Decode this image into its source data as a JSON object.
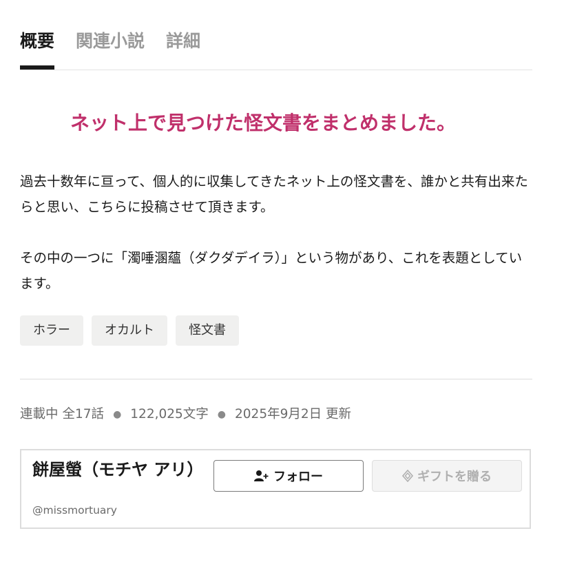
{
  "tabs": [
    {
      "label": "概要",
      "active": true
    },
    {
      "label": "関連小説",
      "active": false
    },
    {
      "label": "詳細",
      "active": false
    }
  ],
  "catchphrase": "ネット上で見つけた怪文書をまとめました。",
  "intro": {
    "paragraph1": "過去十数年に亘って、個人的に収集してきたネット上の怪文書を、誰かと共有出来たらと思い、こちらに投稿させて頂きます。",
    "paragraph2": "その中の一つに「濁唾溷蘊（ダクダデイラ）」という物があり、これを表題としています。"
  },
  "tags": [
    "ホラー",
    "オカルト",
    "怪文書"
  ],
  "meta": {
    "status": "連載中",
    "episodes": "全17話",
    "characters": "122,025文字",
    "updated": "2025年9月2日 更新"
  },
  "author": {
    "name": "餅屋螢（モチヤ アリ）",
    "handle": "@missmortuary",
    "follow_label": "フォロー",
    "gift_label": "ギフトを贈る"
  },
  "colors": {
    "accent": "#c0306b",
    "active_tab": "#1a1a1a",
    "inactive_tab": "#9a9a9a",
    "tag_bg": "#f0f0ef"
  },
  "icons": [
    "add-user-icon",
    "gift-diamond-icon"
  ]
}
